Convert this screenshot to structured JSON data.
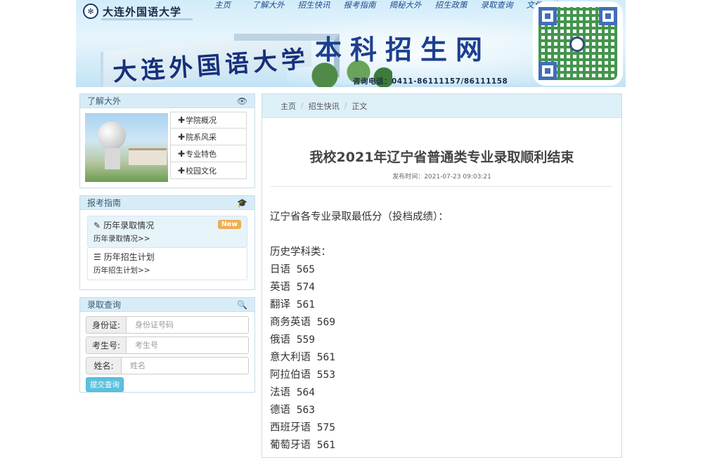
{
  "header": {
    "logo_text": "大连外国语大学",
    "campus_name": "大连外国语大学",
    "site_title": "本科招生网",
    "phone": "咨询电话：0411-86111157/86111158",
    "nav": [
      "主页",
      "了解大外",
      "招生快讯",
      "报考指南",
      "揭秘大外",
      "招生政策",
      "录取查询",
      "文件下载"
    ]
  },
  "sidebar": {
    "about": {
      "title": "了解大外",
      "icon": "eye-icon",
      "items": [
        "学院概况",
        "院系风采",
        "专业特色",
        "校园文化"
      ]
    },
    "guide": {
      "title": "报考指南",
      "icon": "graduation-cap-icon",
      "items": [
        {
          "title": "历年录取情况",
          "sub": "历年录取情况>>",
          "badge": "New",
          "icon": "pencil-icon"
        },
        {
          "title": "历年招生计划",
          "sub": "历年招生计划>>",
          "icon": "list-icon"
        }
      ]
    },
    "query": {
      "title": "录取查询",
      "icon": "search-icon",
      "fields": [
        {
          "label": "身份证:",
          "placeholder": "身份证号码"
        },
        {
          "label": "考生号:",
          "placeholder": "考生号"
        },
        {
          "label": "姓名:",
          "placeholder": "姓名"
        }
      ],
      "submit": "提交查询"
    }
  },
  "main": {
    "breadcrumb": [
      "主页",
      "招生快讯",
      "正文"
    ],
    "title": "我校2021年辽宁省普通类专业录取顺利结束",
    "meta": "发布时间：2021-07-23 09:03:21",
    "intro": "辽宁省各专业录取最低分（投档成绩）：",
    "category": "历史学科类：",
    "scores": [
      "日语 565",
      "英语 574",
      "翻译 561",
      "商务英语 569",
      "俄语 559",
      "意大利语 561",
      "阿拉伯语 553",
      "法语 564",
      "德语 563",
      "西班牙语 575",
      "葡萄牙语 561"
    ]
  },
  "colors": {
    "panel_head": "#d7ecf6",
    "nav_text": "#1e4b8c",
    "title_blue": "#1d3f8f",
    "badge": "#f0ad4e",
    "button": "#5bc0de"
  }
}
